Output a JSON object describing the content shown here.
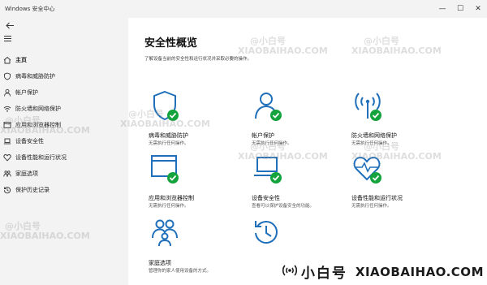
{
  "window": {
    "title": "Windows 安全中心",
    "controls": [
      "—",
      "☐",
      "✕"
    ]
  },
  "sidebar": {
    "items": [
      {
        "label": "主页",
        "icon": "home-icon"
      },
      {
        "label": "病毒和威胁防护",
        "icon": "shield-icon"
      },
      {
        "label": "帐户保护",
        "icon": "person-icon"
      },
      {
        "label": "防火墙和网络保护",
        "icon": "wifi-icon"
      },
      {
        "label": "应用和浏览器控制",
        "icon": "app-window-icon"
      },
      {
        "label": "设备安全性",
        "icon": "laptop-icon"
      },
      {
        "label": "设备性能和运行状况",
        "icon": "heart-icon"
      },
      {
        "label": "家庭选项",
        "icon": "family-icon"
      },
      {
        "label": "保护历史记录",
        "icon": "history-icon"
      }
    ]
  },
  "main": {
    "title": "安全性概览",
    "subtitle": "了解设备当前的安全性和运行状况并采取必要的操作。",
    "tiles": [
      {
        "name": "病毒和威胁防护",
        "status": "无需执行任何操作。",
        "icon": "shield-check-icon"
      },
      {
        "name": "帐户保护",
        "status": "无需执行任何操作。",
        "icon": "person-check-icon"
      },
      {
        "name": "防火墙和网络保护",
        "status": "无需执行任何操作。",
        "icon": "antenna-check-icon"
      },
      {
        "name": "应用和浏览器控制",
        "status": "无需执行任何操作。",
        "icon": "browser-check-icon"
      },
      {
        "name": "设备安全性",
        "status": "查看可以保护设备安全的功能。",
        "icon": "laptop-check-icon"
      },
      {
        "name": "设备性能和运行状况",
        "status": "无需执行任何操作。",
        "icon": "heart-pulse-check-icon"
      },
      {
        "name": "家庭选项",
        "status": "管理你的家人使用设备的方式。",
        "icon": "family-icon"
      },
      {
        "name": "",
        "status": "",
        "icon": "history-icon"
      }
    ]
  },
  "watermark": {
    "cn": "@小白号",
    "en": "XIAOBAIHAO.COM"
  },
  "brand": {
    "cn": "小白号",
    "en": "XIAOBAIHAO.COM"
  },
  "colors": {
    "accent": "#1f6fba",
    "ok_green": "#14a33c",
    "sidebar_bg": "#f3f3f3"
  }
}
